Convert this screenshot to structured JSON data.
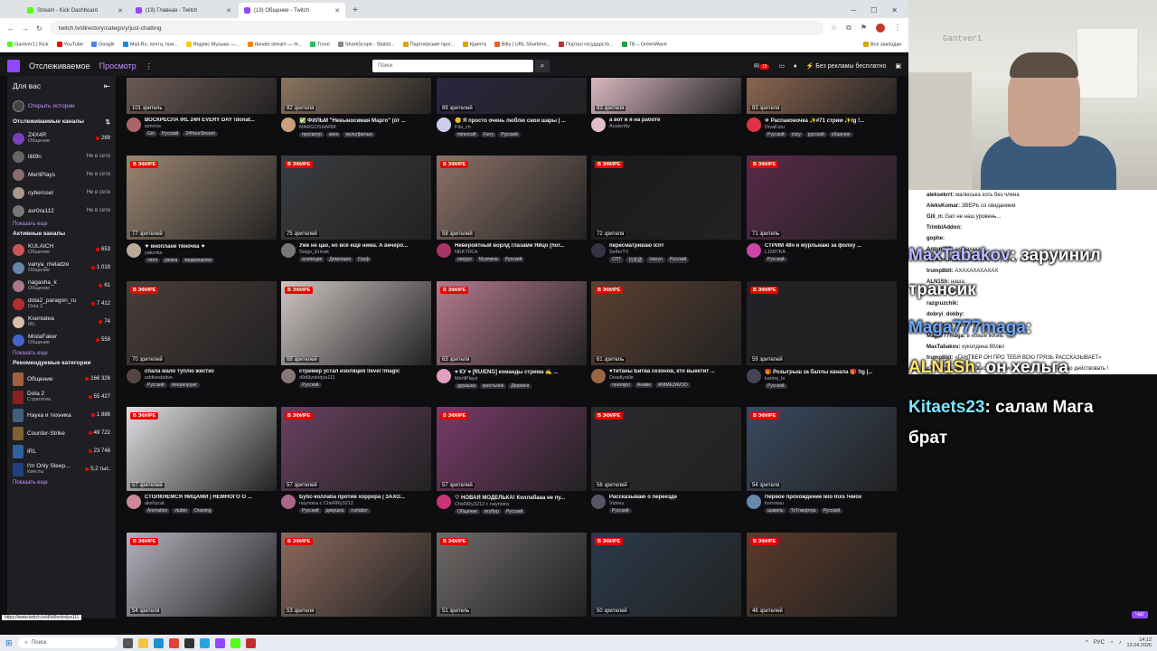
{
  "browser": {
    "tabs": [
      {
        "title": "Stream - Kick Dashboard",
        "icon": "kick-icon",
        "active": false
      },
      {
        "title": "(19) Главная - Twitch",
        "icon": "twitch-icon",
        "active": false
      },
      {
        "title": "(19) Общение - Twitch",
        "icon": "twitch-icon",
        "active": true
      }
    ],
    "url": "twitch.tv/directory/category/just-chatting",
    "bookmarks": [
      "Gantver1 | Kick",
      "YouTube",
      "Google",
      "Mail.Ru: почта, пои...",
      "Яндекс Музыка —...",
      "donate.stream — Н...",
      "Trovo",
      "SharkScope - Statist...",
      "Партнерские прог...",
      "Крипта",
      "Bitly | URL Shortene...",
      "Портал государств...",
      "TB – GreenWave",
      "Все закладки"
    ]
  },
  "nav": {
    "following": "Отслеживаемое",
    "browse": "Просмотр",
    "search_placeholder": "Поиск",
    "notifications": "19",
    "no_ads": "Без рекламы бесплатно"
  },
  "sidebar": {
    "for_you": "Для вас",
    "open_history": "Открыть истории",
    "followed_title": "Отслеживаемые каналы",
    "followed": [
      {
        "name": "Z4X4R",
        "sub": "Общение",
        "viewers": "269",
        "live": true
      },
      {
        "name": "lilit9n",
        "sub": "",
        "viewers": "Не в сети",
        "live": false
      },
      {
        "name": "MerliPlays",
        "sub": "",
        "viewers": "Не в сети",
        "live": false
      },
      {
        "name": "cyberosel",
        "sub": "",
        "viewers": "Не в сети",
        "live": false
      },
      {
        "name": "avr0ra112",
        "sub": "",
        "viewers": "Не в сети",
        "live": false
      }
    ],
    "show_more": "Показать еще",
    "active_title": "Активные каналы",
    "active": [
      {
        "name": "KULAICH",
        "sub": "Общение",
        "viewers": "653"
      },
      {
        "name": "vanya_meladze",
        "sub": "Общение",
        "viewers": "1 019"
      },
      {
        "name": "nagasha_k",
        "sub": "Общение",
        "viewers": "61"
      },
      {
        "name": "dota2_paragon_ru",
        "sub": "Dota 2",
        "viewers": "7 412"
      },
      {
        "name": "Kseniatea",
        "sub": "IRL",
        "viewers": "74"
      },
      {
        "name": "MistaFaker",
        "sub": "Общение",
        "viewers": "559"
      }
    ],
    "categories_title": "Рекомендуемые категории",
    "categories": [
      {
        "name": "Общение",
        "sub": "",
        "viewers": "166 326"
      },
      {
        "name": "Dota 2",
        "sub": "Стратегии",
        "viewers": "55 427"
      },
      {
        "name": "Наука и техника",
        "sub": "",
        "viewers": "1 886"
      },
      {
        "name": "Counter-Strike",
        "sub": "",
        "viewers": "49 722"
      },
      {
        "name": "IRL",
        "sub": "",
        "viewers": "23 748"
      },
      {
        "name": "I'm Only Sleep...",
        "sub": "Квесты",
        "viewers": "5,2 тыс."
      }
    ]
  },
  "live_label": "В ЭФИРЕ",
  "streams": [
    {
      "viewers": "101 зритель",
      "title": "ВОСКРЕСЛА IRL 24H EVERY DAY !donat...",
      "channel": "wmrrrw",
      "tags": [
        "Girl",
        "Русский",
        "24HourStream"
      ],
      "live": false,
      "color": "#6b5a55",
      "av": "#aa6666"
    },
    {
      "viewers": "82 зрителя",
      "title": "✅ ФИЛЬМ \"Невыносимая Марго\" (от ...",
      "channel": "MARGOSHARM",
      "tags": [
        "просмотр",
        "кино",
        "мультфильм"
      ],
      "live": false,
      "color": "#8a7560",
      "av": "#caa080"
    },
    {
      "viewers": "89 зрителей",
      "title": "😊 Я просто очень люблю свои шары | ...",
      "channel": "Fibi_ch",
      "tags": [
        "minecraft",
        "Furry",
        "Русский"
      ],
      "live": false,
      "color": "#2c2540",
      "av": "#ccccee"
    },
    {
      "viewers": "83 зрителя",
      "title": "а вот и я на работе",
      "channel": "Austeritty",
      "tags": [],
      "live": false,
      "color": "#d9b8c0",
      "av": "#e0c0c8"
    },
    {
      "viewers": "83 зрителя",
      "title": "✈ Распаковочка ✨#71 стрим ✨tg !...",
      "channel": "DivaFutu",
      "tags": [
        "Русский",
        "cozy",
        "русский",
        "общение"
      ],
      "live": false,
      "color": "#8a6550",
      "av": "#dd3344"
    },
    {
      "viewers": "77 зрителей",
      "title": "✦ иноплане тяночка ✦",
      "channel": "yakorka",
      "tags": [
        "чилл",
        "ржака",
        "медиакарлик"
      ],
      "live": true,
      "color": "#9c8672",
      "av": "#bbaa99"
    },
    {
      "viewers": "75 зрителей",
      "title": "Уже не цао, но всё ещё нима. А вечеро...",
      "channel": "Saigo_Ermak",
      "tags": [
        "алопеция",
        "Деменция",
        "Скуф"
      ],
      "live": true,
      "color": "#3a3d40",
      "av": "#777777"
    },
    {
      "viewers": "58 зрителей",
      "title": "Невероятный ворлд глазами Яйцо [hor...",
      "channel": "NEKYRUx",
      "tags": [
        "некуро",
        "Мужчина",
        "Русский"
      ],
      "live": true,
      "color": "#8c7268",
      "av": "#aa3366"
    },
    {
      "viewers": "72 зрителя",
      "title": "пересматриваю Icnт",
      "channel": "SeiferTV",
      "tags": [
        "СПТ",
        "日本語",
        "xiaoyu",
        "Русский"
      ],
      "live": true,
      "color": "#1a1a1e",
      "av": "#333344"
    },
    {
      "viewers": "71 зритель",
      "title": "СТРИМ 48ч и мурлыкаю за фолоу ...",
      "channel": "L1MITKA",
      "tags": [
        "Русский"
      ],
      "live": true,
      "color": "#5a2a4a",
      "av": "#cc44aa"
    },
    {
      "viewers": "70 зрителей",
      "title": "спала мало туплю жестко",
      "channel": "oddisedative",
      "tags": [
        "Русский",
        "sleepenjoyer"
      ],
      "live": true,
      "color": "#4a3c3a",
      "av": "#554444"
    },
    {
      "viewers": "68 зрителей",
      "title": "стример устал изоляция !level !magic",
      "channel": "d9d9volodya111",
      "tags": [
        "Русский"
      ],
      "live": true,
      "color": "#cfc6c4",
      "av": "#887777"
    },
    {
      "viewers": "63 зрителя",
      "title": "♥ КУ ♥ [RU/ENG] команды стрима ✍ ...",
      "channel": "MerliPlays",
      "tags": [
        "дурашка",
        "крестьяне",
        "Деревня"
      ],
      "live": true,
      "color": "#b47a90",
      "av": "#e0a0c0"
    },
    {
      "viewers": "61 зритель",
      "title": "♥Титаны Битва сезонов, кто выкетит ...",
      "channel": "Deadlystile",
      "tags": [
        "гачагирл",
        "Аниме",
        "ANIMEZAVOD"
      ],
      "live": true,
      "color": "#5a4030",
      "av": "#996644"
    },
    {
      "viewers": "59 зрителей",
      "title": "🎁 Розыгрыш за баллы канала 🎁 !tg |...",
      "channel": "karina_tv",
      "tags": [
        "Русский"
      ],
      "live": true,
      "color": "#222226",
      "av": "#444455"
    },
    {
      "viewers": "57 зрителей",
      "title": "СТОЛКНЕМСЯ ЯЙЦАМИ | НЕМНОГО О ...",
      "channel": "akshycat",
      "tags": [
        "Animation",
        "vtuber",
        "Drawing"
      ],
      "live": true,
      "color": "#e0e0e4",
      "av": "#cc8899"
    },
    {
      "viewers": "57 зрителей",
      "title": "Бубс-коллаба против хоррора | ЗАХО...",
      "channel": "naynoira с CheRRy3212",
      "tags": [
        "Русский",
        "девушка",
        "ruvtuber"
      ],
      "live": true,
      "color": "#6a4060",
      "av": "#aa6688"
    },
    {
      "viewers": "57 зрителей",
      "title": "♡ НОВАЯ МОДЕЛЬКА! Коллабааа не пу...",
      "channel": "CheRRy3212 с naynoira",
      "tags": [
        "Общение",
        "втубер",
        "Русский"
      ],
      "live": true,
      "color": "#7a3a6a",
      "av": "#cc3377"
    },
    {
      "viewers": "56 зрителей",
      "title": "Рассказываю о переезде",
      "channel": "Vizkeu",
      "tags": [
        "Русский"
      ],
      "live": true,
      "color": "#2a2a2e",
      "av": "#555566"
    },
    {
      "viewers": "54 зрителя",
      "title": "Первое прохождение lelo Inxs !чмок",
      "channel": "korrossu",
      "tags": [
        "щавель",
        "ТоТлмортра",
        "Русский"
      ],
      "live": true,
      "color": "#3a4a60",
      "av": "#6688aa"
    },
    {
      "viewers": "54 зрителя",
      "title": "",
      "channel": "",
      "tags": [],
      "live": true,
      "color": "#b4b0bc",
      "av": "#999999"
    },
    {
      "viewers": "53 зрителя",
      "title": "",
      "channel": "",
      "tags": [],
      "live": true,
      "color": "#8c6a5e",
      "av": "#999999"
    },
    {
      "viewers": "51 зритель",
      "title": "",
      "channel": "",
      "tags": [],
      "live": true,
      "color": "#6e6a68",
      "av": "#999999"
    },
    {
      "viewers": "50 зрителей",
      "title": "",
      "channel": "",
      "tags": [],
      "live": true,
      "color": "#2a3a4a",
      "av": "#999999"
    },
    {
      "viewers": "48 зрителей",
      "title": "",
      "channel": "",
      "tags": [],
      "live": true,
      "color": "#5a3a2a",
      "av": "#999999"
    }
  ],
  "webcam_label": "Gantver1",
  "chat": [
    {
      "user": "aleksekrrt:",
      "text": "малюська хоть без члена"
    },
    {
      "user": "AleksKomar:",
      "text": "ЗВЕРЬ со свиданием"
    },
    {
      "user": "Gili_n:",
      "text": "Gan не наш уровень..."
    },
    {
      "user": "TrimblAddon:",
      "text": ""
    },
    {
      "user": "gophe:",
      "text": ""
    },
    {
      "user": "Antonpk2:",
      "text": "ахахахаха"
    },
    {
      "user": "slowdown666:",
      "text": "жаль сосёт эту хуету электронную"
    },
    {
      "user": "trump8bit:",
      "text": "АХАХАХАХАХАХ"
    },
    {
      "user": "ALN1Sh:",
      "text": "наша"
    },
    {
      "user": "razgruzchik:",
      "text": ""
    },
    {
      "user": "razgruzchik:",
      "text": ""
    },
    {
      "user": "dobryi_dobby:",
      "text": ""
    },
    {
      "user": "fl_4ming0:",
      "text": "наша точно"
    },
    {
      "user": "Maga777maga:",
      "text": "в новые жизнь"
    },
    {
      "user": "MaxTabakov:",
      "text": "куколдина 80лвл"
    },
    {
      "user": "trump8bit:",
      "text": "«ГАНТВЕР ОН ПРО ТЕБЯ ВСЮ ГРЯЗЬ РАССКАЗЫВАЕТ»"
    },
    {
      "user": "cTonapuk:",
      "text": "ей жопа вас двоих сможет прокормить - нужно действовать !"
    }
  ],
  "big_messages": [
    {
      "user": "MaxTabakov",
      "text": ": заруинил"
    },
    {
      "user": "",
      "text": "трансик"
    },
    {
      "user": "Maga777maga",
      "text": ":"
    },
    {
      "user": "ALN1Sh",
      "text": ": он хельга"
    },
    {
      "user": "Kitaets23",
      "text": ": салам Мага"
    },
    {
      "user": "",
      "text": "брат"
    }
  ],
  "chat_button": "Чат",
  "status_url": "https://www.twitch.tv/d9d9volodya111",
  "taskbar": {
    "search": "Поиск",
    "lang": "РУС",
    "time": "14:12",
    "date": "13.04.2026"
  }
}
